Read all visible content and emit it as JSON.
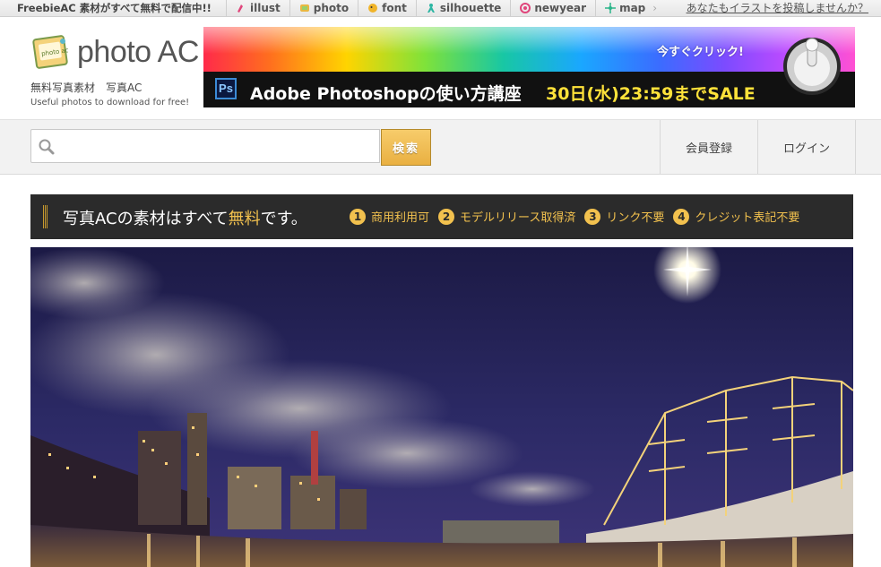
{
  "topbar": {
    "brand": "FreebieAC 素材がすべて無料で配信中!!",
    "tabs": [
      {
        "label": "illust",
        "icon": "illust-icon",
        "color": "#e0457b"
      },
      {
        "label": "photo",
        "icon": "photo-icon",
        "color": "#e9b841"
      },
      {
        "label": "font",
        "icon": "font-icon",
        "color": "#f0b429"
      },
      {
        "label": "silhouette",
        "icon": "silhouette-icon",
        "color": "#2bb5a3"
      },
      {
        "label": "newyear",
        "icon": "newyear-icon",
        "color": "#e0457b"
      },
      {
        "label": "map",
        "icon": "map-icon",
        "color": "#2bb58a"
      }
    ],
    "submit_link": "あなたもイラストを投稿しませんか？"
  },
  "header": {
    "logo_text": "photo AC",
    "logo_badge": "photo ac",
    "tagline_jp": "無料写真素材　写真AC",
    "tagline_en": "Useful photos to download for free!"
  },
  "banner": {
    "cta": "今すぐクリック!",
    "ps_label": "Ps",
    "title": "Adobe Photoshopの使い方講座",
    "date": "30日(水)23:59までSALE"
  },
  "search": {
    "placeholder": "",
    "value": "",
    "button_label": "検索"
  },
  "nav": {
    "register": "会員登録",
    "login": "ログイン"
  },
  "features": {
    "headline_pre": "写真ACの素材はすべて",
    "headline_free": "無料",
    "headline_post": "です。",
    "items": [
      {
        "num": "1",
        "label": "商用利用可"
      },
      {
        "num": "2",
        "label": "モデルリリース取得済"
      },
      {
        "num": "3",
        "label": "リンク不要"
      },
      {
        "num": "4",
        "label": "クレジット表記不要"
      }
    ]
  },
  "colors": {
    "accent_gold": "#f2c14e",
    "dark_bar": "#2b2b2b",
    "search_button": "#e9b041"
  }
}
